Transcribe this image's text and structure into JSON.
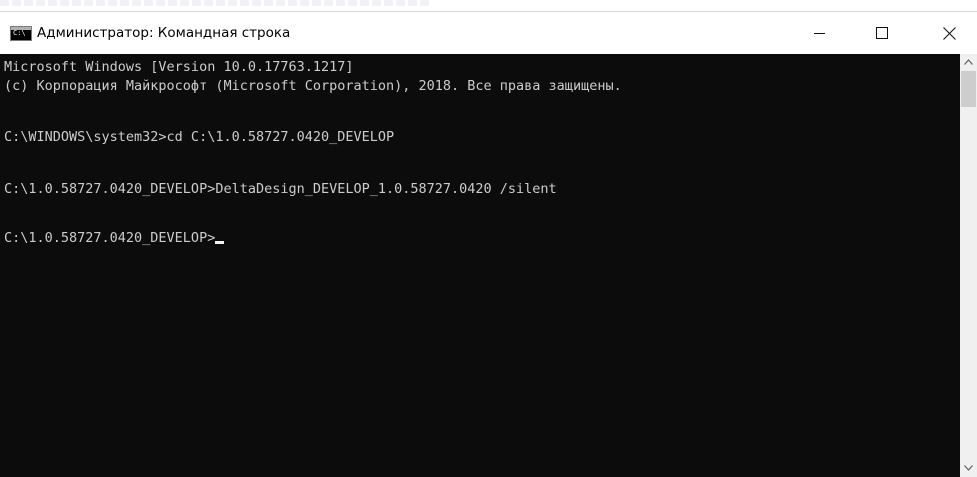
{
  "window": {
    "icon_text": "C:\\",
    "title": "Администратор: Командная строка"
  },
  "controls": {
    "minimize": "minimize",
    "maximize": "maximize",
    "close": "close"
  },
  "console": {
    "lines": [
      "Microsoft Windows [Version 10.0.17763.1217]",
      "(c) Корпорация Майкрософт (Microsoft Corporation), 2018. Все права защищены.",
      "",
      "C:\\WINDOWS\\system32>cd C:\\1.0.58727.0420_DEVELOP",
      "",
      "C:\\1.0.58727.0420_DEVELOP>DeltaDesign_DEVELOP_1.0.58727.0420 /silent",
      "",
      "C:\\1.0.58727.0420_DEVELOP>"
    ]
  },
  "colors": {
    "console_bg": "#0c0c0c",
    "console_text": "#cccccc",
    "title_bar_bg": "#ffffff",
    "scrollbar_track": "#f0f0f0"
  }
}
